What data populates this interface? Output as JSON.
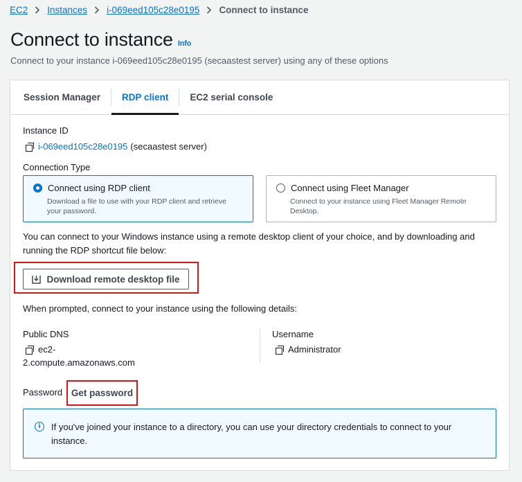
{
  "breadcrumb": {
    "items": [
      "EC2",
      "Instances",
      "i-069eed105c28e0195"
    ],
    "current": "Connect to instance"
  },
  "header": {
    "title": "Connect to instance",
    "info_label": "Info",
    "subtitle": "Connect to your instance i-069eed105c28e0195 (secaastest server) using any of these options"
  },
  "tabs": [
    {
      "label": "Session Manager",
      "active": false
    },
    {
      "label": "RDP client",
      "active": true
    },
    {
      "label": "EC2 serial console",
      "active": false
    }
  ],
  "instance": {
    "id_label": "Instance ID",
    "id": "i-069eed105c28e0195",
    "name": "(secaastest server)"
  },
  "connection_type": {
    "label": "Connection Type",
    "options": [
      {
        "title": "Connect using RDP client",
        "desc_line1": "Download a file to use with your RDP client and retrieve",
        "desc_line2": "your password.",
        "selected": true
      },
      {
        "title": "Connect using Fleet Manager",
        "desc_line1": "Connect to your instance using Fleet Manager Remote",
        "desc_line2": "Desktop.",
        "selected": false
      }
    ]
  },
  "rdp": {
    "para_line1": "You can connect to your Windows instance using a remote desktop client of your choice, and by downloading and",
    "para_line2": "running the RDP shortcut file below:",
    "download_label": "Download remote desktop file",
    "prompted": "When prompted, connect to your instance using the following details:"
  },
  "details": {
    "dns_label": "Public DNS",
    "dns_line1": "ec2-",
    "dns_line2": "2.compute.amazonaws.com",
    "username_label": "Username",
    "username": "Administrator",
    "password_label": "Password",
    "get_password_label": "Get password"
  },
  "alert": {
    "line1": "If you've joined your instance to a directory, you can use your directory credentials to connect to your",
    "line2": "instance."
  },
  "colors": {
    "link": "#0972d3",
    "highlight_box": "#d91515",
    "selected_tile_bg": "#f1faff"
  }
}
